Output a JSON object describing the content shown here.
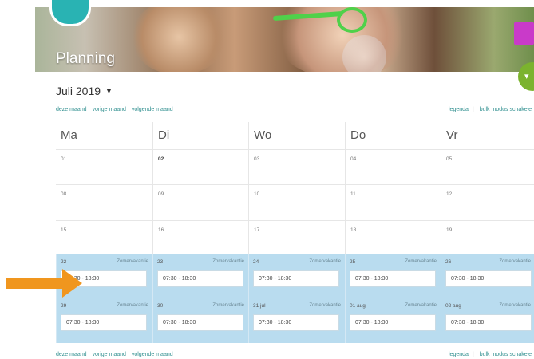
{
  "header": {
    "title": "Planning"
  },
  "calendar": {
    "month": "Juli 2019",
    "nav": {
      "this_month": "deze maand",
      "prev_month": "vorige maand",
      "next_month": "volgende maand"
    },
    "right_nav": {
      "legend": "legenda",
      "sep": "|",
      "bulk": "bulk modus schakele"
    },
    "days": [
      "Ma",
      "Di",
      "Wo",
      "Do",
      "Vr"
    ],
    "weeks": [
      [
        "01",
        "02",
        "03",
        "04",
        "05"
      ],
      [
        "08",
        "09",
        "10",
        "11",
        "12"
      ],
      [
        "15",
        "16",
        "17",
        "18",
        "19"
      ]
    ],
    "vacation_label": "Zomervakantie",
    "vacation_weeks": [
      [
        {
          "date": "22",
          "time": "07:30 - 18:30"
        },
        {
          "date": "23",
          "time": "07:30 - 18:30"
        },
        {
          "date": "24",
          "time": "07:30 - 18:30"
        },
        {
          "date": "25",
          "time": "07:30 - 18:30"
        },
        {
          "date": "26",
          "time": "07:30 - 18:30"
        }
      ],
      [
        {
          "date": "29",
          "time": "07:30 - 18:30"
        },
        {
          "date": "30",
          "time": "07:30 - 18:30"
        },
        {
          "date": "31 jul",
          "time": "07:30 - 18:30"
        },
        {
          "date": "01 aug",
          "time": "07:30 - 18:30"
        },
        {
          "date": "02 aug",
          "time": "07:30 - 18:30"
        }
      ]
    ]
  },
  "colors": {
    "accent": "#2f8f8f",
    "vacation": "#b9dcef",
    "arrow": "#f0961e",
    "fab": "#7bb32e"
  }
}
